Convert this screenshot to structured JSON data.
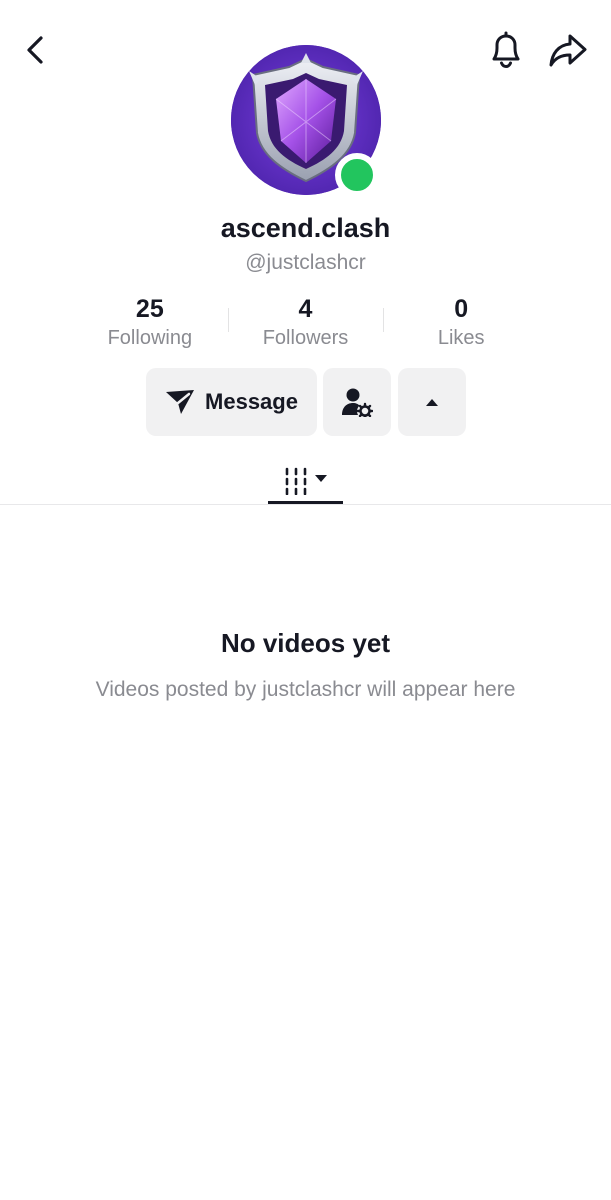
{
  "profile": {
    "display_name": "ascend.clash",
    "handle": "@justclashcr",
    "online": true
  },
  "stats": [
    {
      "value": "25",
      "label": "Following"
    },
    {
      "value": "4",
      "label": "Followers"
    },
    {
      "value": "0",
      "label": "Likes"
    }
  ],
  "actions": {
    "message_label": "Message"
  },
  "empty_state": {
    "title": "No videos yet",
    "subtitle": "Videos posted by justclashcr will appear here"
  },
  "colors": {
    "text_primary": "#161823",
    "text_secondary": "#8a8b91",
    "button_bg": "#f1f1f2",
    "online": "#22c55e",
    "avatar_bg": "#5a2db8"
  },
  "icons": {
    "back": "chevron-left-icon",
    "notifications": "bell-icon",
    "share": "share-arrow-icon",
    "message": "paper-plane-icon",
    "friend_settings": "person-gear-icon",
    "more": "triangle-up-icon",
    "videos_tab": "grid-filter-icon"
  }
}
